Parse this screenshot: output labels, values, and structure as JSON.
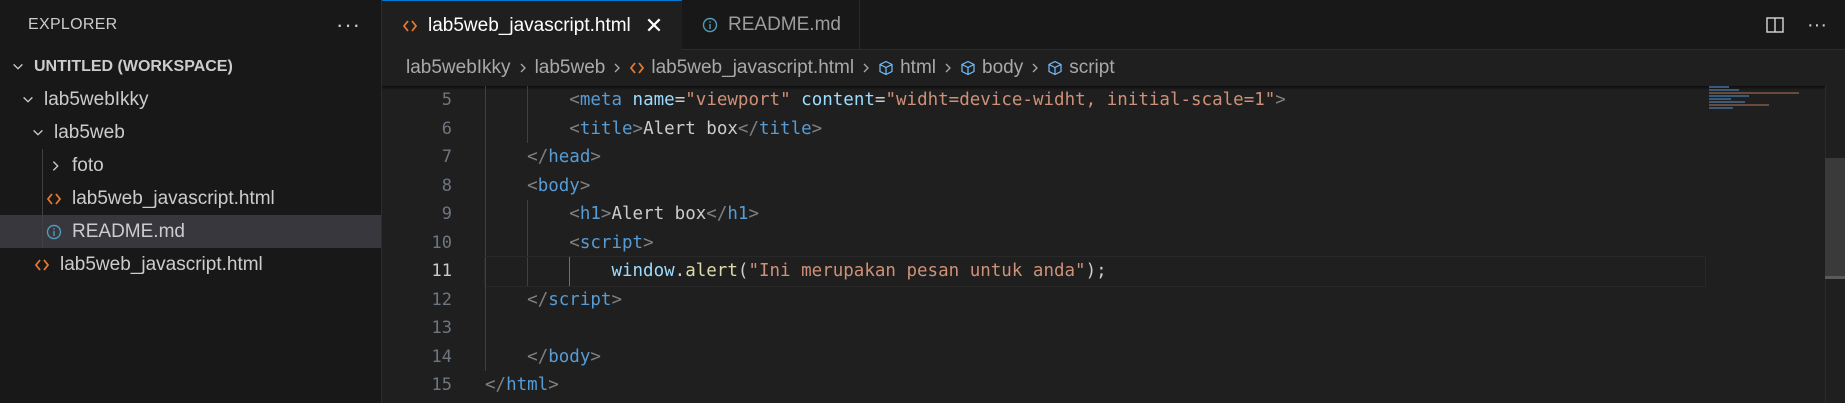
{
  "explorer": {
    "title": "EXPLORER",
    "more_icon": "ellipsis-icon",
    "items": [
      {
        "label": "UNTITLED (WORKSPACE)",
        "type": "section",
        "expanded": true
      },
      {
        "label": "lab5webIkky",
        "type": "folder",
        "expanded": true
      },
      {
        "label": "lab5web",
        "type": "folder",
        "expanded": true
      },
      {
        "label": "foto",
        "type": "folder",
        "expanded": false
      },
      {
        "label": "lab5web_javascript.html",
        "type": "html-file"
      },
      {
        "label": "README.md",
        "type": "info-file",
        "selected": true
      },
      {
        "label": "lab5web_javascript.html",
        "type": "html-file"
      }
    ]
  },
  "tabs": [
    {
      "label": "lab5web_javascript.html",
      "active": true,
      "icon": "html-icon"
    },
    {
      "label": "README.md",
      "active": false,
      "icon": "info-icon"
    }
  ],
  "tab_actions": {
    "split_icon": "split-editor-icon",
    "more_icon": "ellipsis-icon"
  },
  "breadcrumb": [
    "lab5webIkky",
    "lab5web",
    "lab5web_javascript.html",
    "html",
    "body",
    "script"
  ],
  "editor": {
    "current_line": 11,
    "line_numbers": [
      "5",
      "6",
      "7",
      "8",
      "9",
      "10",
      "11",
      "12",
      "13",
      "14",
      "15"
    ],
    "code": {
      "l5": {
        "indent": "        ",
        "open": "<",
        "tag": "meta",
        "a1": "name",
        "eq1": "=",
        "v1": "\"viewport\"",
        "a2": "content",
        "eq2": "=",
        "v2": "\"widht=device-widht, initial-scale=1\"",
        "close": ">"
      },
      "l6": {
        "indent": "        ",
        "open": "<",
        "tag": "title",
        "mid": ">",
        "text": "Alert box",
        "end_open": "</",
        "end_tag": "title",
        "close": ">"
      },
      "l7": {
        "indent": "    ",
        "open": "</",
        "tag": "head",
        "close": ">"
      },
      "l8": {
        "indent": "    ",
        "open": "<",
        "tag": "body",
        "close": ">"
      },
      "l9": {
        "indent": "        ",
        "open": "<",
        "tag": "h1",
        "mid": ">",
        "text": "Alert box",
        "end_open": "</",
        "end_tag": "h1",
        "close": ">"
      },
      "l10": {
        "indent": "        ",
        "open": "<",
        "tag": "script",
        "close": ">"
      },
      "l11": {
        "indent": "            ",
        "obj": "window",
        "dot": ".",
        "fn": "alert",
        "p1": "(",
        "str": "\"Ini merupakan pesan untuk anda\"",
        "p2": ");"
      },
      "l12": {
        "indent": "    ",
        "open": "</",
        "tag": "script",
        "close": ">"
      },
      "l13": {
        "indent": ""
      },
      "l14": {
        "indent": "    ",
        "open": "</",
        "tag": "body",
        "close": ">"
      },
      "l15": {
        "indent": "",
        "open": "</",
        "tag": "html",
        "close": ">"
      }
    }
  },
  "colors": {
    "accent": "#0078d4",
    "html_icon": "#e37933",
    "info_icon": "#519aba"
  }
}
